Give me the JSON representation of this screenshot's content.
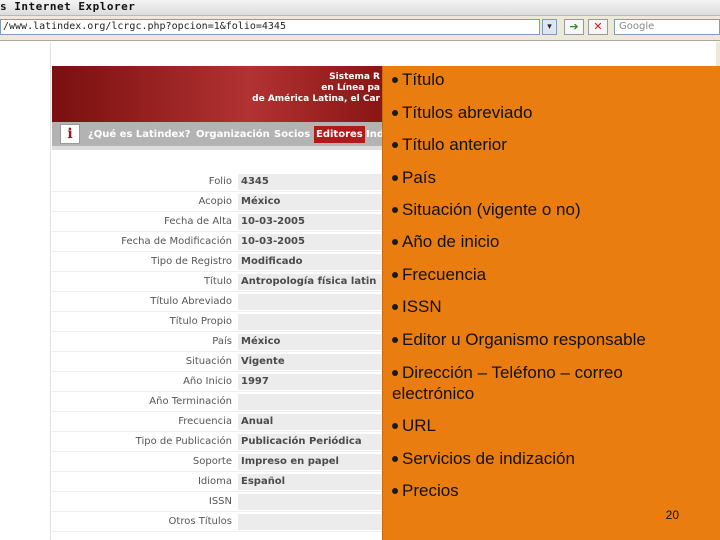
{
  "browser": {
    "title": "s Internet Explorer",
    "address": "/www.latindex.org/lcrgc.php?opcion=1&folio=4345",
    "search_placeholder": "Google"
  },
  "site": {
    "banner_lines": [
      "Sistema R",
      "en Línea pa",
      "de América Latina, el Car"
    ],
    "menu": [
      "¿Qué es Latindex?",
      "Organización",
      "Socios",
      "Editores",
      "Ind"
    ],
    "fields": [
      {
        "label": "Folio",
        "value": "4345"
      },
      {
        "label": "Acopio",
        "value": "México"
      },
      {
        "label": "Fecha de Alta",
        "value": "10-03-2005"
      },
      {
        "label": "Fecha de Modificación",
        "value": "10-03-2005"
      },
      {
        "label": "Tipo de Registro",
        "value": "Modificado"
      },
      {
        "label": "Título",
        "value": "Antropología física latin"
      },
      {
        "label": "Título Abreviado",
        "value": ""
      },
      {
        "label": "Título Propio",
        "value": ""
      },
      {
        "label": "País",
        "value": "México"
      },
      {
        "label": "Situación",
        "value": "Vigente"
      },
      {
        "label": "Año Inicio",
        "value": "1997"
      },
      {
        "label": "Año Terminación",
        "value": ""
      },
      {
        "label": "Frecuencia",
        "value": "Anual"
      },
      {
        "label": "Tipo de Publicación",
        "value": "Publicación Periódica"
      },
      {
        "label": "Soporte",
        "value": "Impreso en papel"
      },
      {
        "label": "Idioma",
        "value": "Español"
      },
      {
        "label": "ISSN",
        "value": ""
      },
      {
        "label": "Otros Títulos",
        "value": ""
      }
    ]
  },
  "panel": {
    "bullets": [
      "Título",
      "Títulos abreviado",
      "Título anterior",
      "País",
      "Situación (vigente o no)",
      "Año de inicio",
      "Frecuencia",
      "ISSN",
      "Editor u Organismo responsable",
      "Dirección – Teléfono – correo",
      "electrónico",
      "URL",
      "Servicios de indización",
      "Precios"
    ],
    "page_number": "20"
  },
  "colors": {
    "panel": "#ea7d10",
    "banner": "#a52424",
    "menu": "#b3b3b3"
  }
}
